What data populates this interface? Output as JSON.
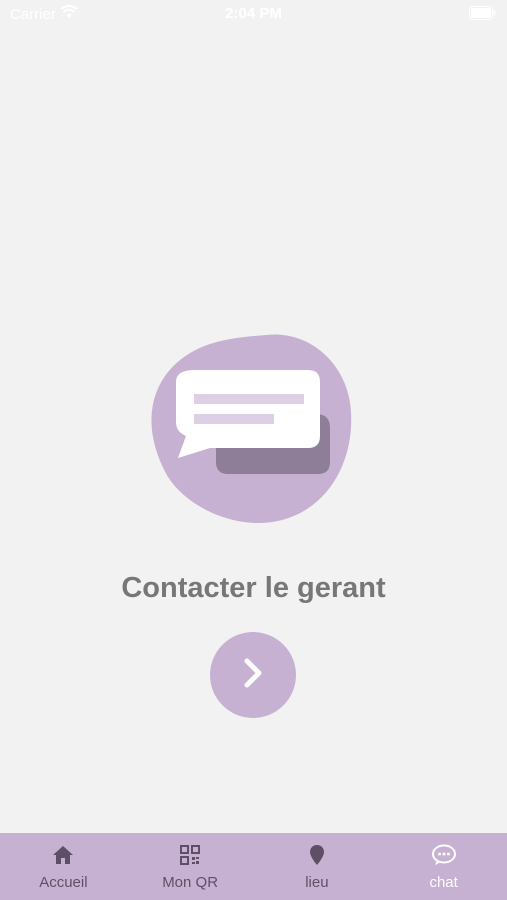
{
  "status_bar": {
    "carrier": "Carrier",
    "time": "2:04 PM"
  },
  "main": {
    "title": "Contacter le gerant"
  },
  "tab_bar": {
    "tabs": [
      {
        "label": "Accueil",
        "icon": "home-icon"
      },
      {
        "label": "Mon QR",
        "icon": "qr-code-icon"
      },
      {
        "label": "lieu",
        "icon": "location-pin-icon"
      },
      {
        "label": "chat",
        "icon": "chat-bubble-icon",
        "active": true
      }
    ]
  },
  "colors": {
    "background": "#f2f2f2",
    "accent": "#c7b1d3",
    "title_text": "#777777",
    "tab_text": "#5e4f66",
    "active_tab_text": "#ffffff"
  }
}
